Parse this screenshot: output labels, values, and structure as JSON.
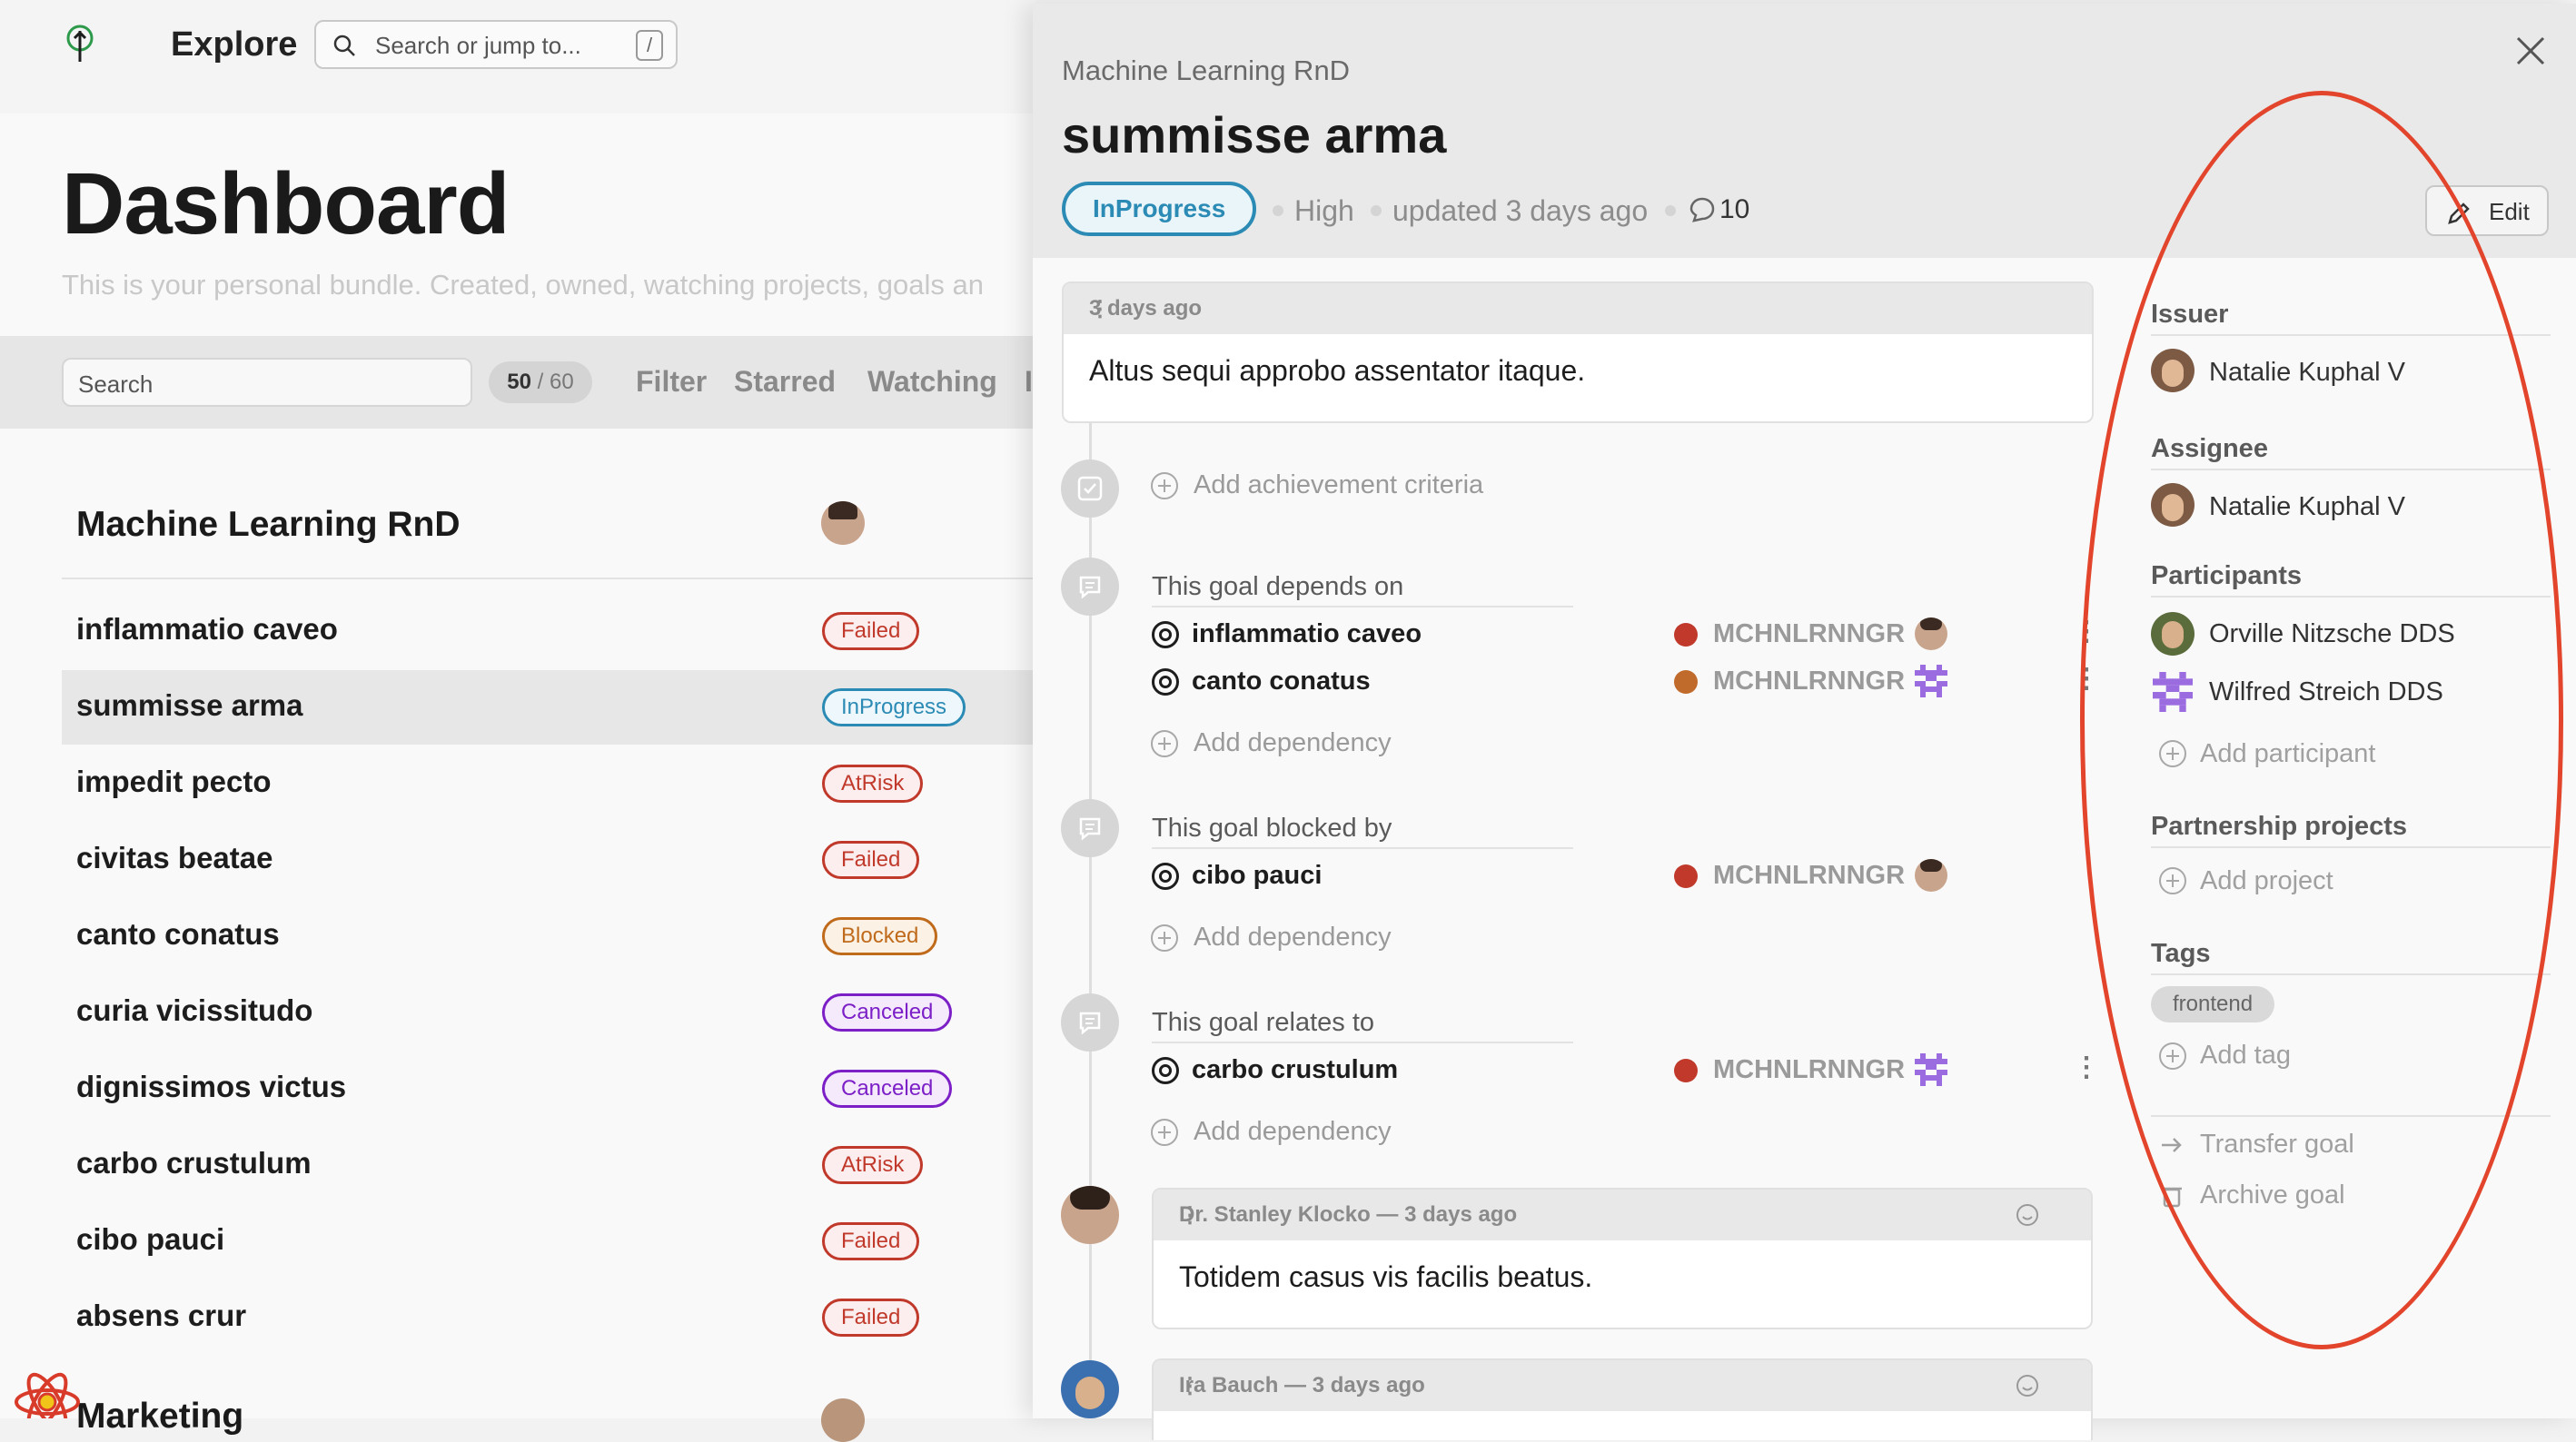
{
  "topbar": {
    "title": "Explore",
    "search_placeholder": "Search or jump to...",
    "search_shortcut": "/"
  },
  "dashboard": {
    "title": "Dashboard",
    "subtitle": "This is your personal bundle. Created, owned, watching projects, goals an",
    "filter": {
      "search_placeholder": "Search",
      "count": "50",
      "total": "/ 60",
      "buttons": [
        "Filter",
        "Starred",
        "Watching",
        "I"
      ]
    },
    "project": {
      "title": "Machine Learning RnD"
    },
    "goals": [
      {
        "name": "inflammatio caveo",
        "status": "Failed"
      },
      {
        "name": "summisse arma",
        "status": "InProgress"
      },
      {
        "name": "impedit pecto",
        "status": "AtRisk"
      },
      {
        "name": "civitas beatae",
        "status": "Failed"
      },
      {
        "name": "canto conatus",
        "status": "Blocked"
      },
      {
        "name": "curia vicissitudo",
        "status": "Canceled"
      },
      {
        "name": "dignissimos victus",
        "status": "Canceled"
      },
      {
        "name": "carbo crustulum",
        "status": "AtRisk"
      },
      {
        "name": "cibo pauci",
        "status": "Failed"
      },
      {
        "name": "absens crur",
        "status": "Failed"
      }
    ],
    "next_project_partial": "Marketing"
  },
  "panel": {
    "project": "Machine Learning RnD",
    "title": "summisse arma",
    "status": "InProgress",
    "priority": "High",
    "updated": "updated 3 days ago",
    "comments_count": "10",
    "edit_label": "Edit",
    "description": {
      "time": "3 days ago",
      "text": "Altus sequi approbo assentator itaque."
    },
    "add_criteria": "Add achievement criteria",
    "depends_on": {
      "title": "This goal depends on",
      "items": [
        {
          "name": "inflammatio caveo",
          "key": "MCHNLRNNGR",
          "dot": "#c0392b"
        },
        {
          "name": "canto conatus",
          "key": "MCHNLRNNGR",
          "dot": "#c06a2b"
        }
      ],
      "add": "Add dependency"
    },
    "blocked_by": {
      "title": "This goal blocked by",
      "items": [
        {
          "name": "cibo pauci",
          "key": "MCHNLRNNGR",
          "dot": "#c0392b"
        }
      ],
      "add": "Add dependency"
    },
    "relates_to": {
      "title": "This goal relates to",
      "items": [
        {
          "name": "carbo crustulum",
          "key": "MCHNLRNNGR",
          "dot": "#c0392b"
        }
      ],
      "add": "Add dependency"
    },
    "comments": [
      {
        "author_time": "Dr. Stanley Klocko — 3 days ago",
        "text": "Totidem casus vis facilis beatus."
      },
      {
        "author_time": "Ira Bauch — 3 days ago",
        "text": ""
      }
    ],
    "sidebar": {
      "issuer_label": "Issuer",
      "issuer": "Natalie Kuphal V",
      "assignee_label": "Assignee",
      "assignee": "Natalie Kuphal V",
      "participants_label": "Participants",
      "participants": [
        "Orville Nitzsche DDS",
        "Wilfred Streich DDS"
      ],
      "add_participant": "Add participant",
      "partnership_label": "Partnership projects",
      "add_project": "Add project",
      "tags_label": "Tags",
      "tags": [
        "frontend"
      ],
      "add_tag": "Add tag",
      "transfer": "Transfer goal",
      "archive": "Archive goal"
    }
  },
  "colors": {
    "annotation_ring": "#e2452b",
    "inprogress": "#2b8bb5",
    "failed": "#c0392b",
    "blocked": "#c06a1b",
    "canceled": "#7c1fc7"
  }
}
